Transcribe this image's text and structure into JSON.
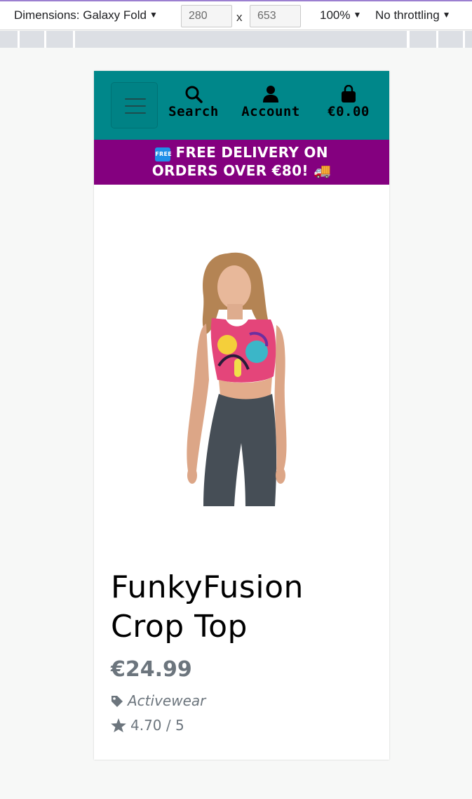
{
  "devtools": {
    "dimensions_label": "Dimensions: Galaxy Fold",
    "width_value": "280",
    "height_value": "653",
    "times": "x",
    "zoom": "100%",
    "throttling": "No throttling"
  },
  "nav": {
    "search_label": "Search",
    "account_label": "Account",
    "cart_total": "€0.00",
    "background": "#00878a"
  },
  "banner": {
    "free_badge": "FREE",
    "line1": "FREE DELIVERY ON",
    "line2": "ORDERS OVER €80! 🚚",
    "background": "#84007f"
  },
  "product": {
    "title_line1": "FunkyFusion",
    "title_line2": "Crop Top",
    "price": "€24.99",
    "category": "Activewear",
    "rating": "4.70 / 5"
  },
  "icons": {
    "menu": "hamburger-icon",
    "search": "search-icon",
    "account": "user-icon",
    "cart": "shopping-bag-icon",
    "category": "tag-icon",
    "rating": "star-icon"
  }
}
